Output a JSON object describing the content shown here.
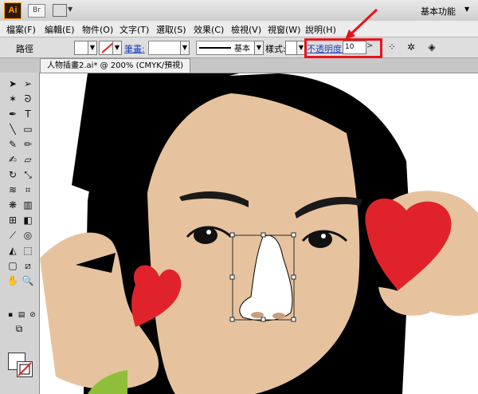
{
  "app": {
    "logo": "Ai",
    "bridge": "Br",
    "workspace": "基本功能"
  },
  "menu": [
    {
      "label": "檔案(F)"
    },
    {
      "label": "編輯(E)"
    },
    {
      "label": "物件(O)"
    },
    {
      "label": "文字(T)"
    },
    {
      "label": "選取(S)"
    },
    {
      "label": "效果(C)"
    },
    {
      "label": "檢視(V)"
    },
    {
      "label": "視窗(W)"
    },
    {
      "label": "說明(H)"
    }
  ],
  "control": {
    "selection_type": "路徑",
    "stroke_label": "筆畫:",
    "brush_name": "基本",
    "style_label": "樣式:",
    "opacity_label": "不透明度:",
    "opacity_value": "10"
  },
  "document": {
    "tab_title": "人物插畫2.ai* @ 200% (CMYK/預視)"
  },
  "colors": {
    "highlight": "#e8131b",
    "skin": "#e6c39e",
    "hair": "#000000",
    "heart": "#e0232a",
    "nose_fill": "#ffffff",
    "selection": "#2b2b2b"
  }
}
